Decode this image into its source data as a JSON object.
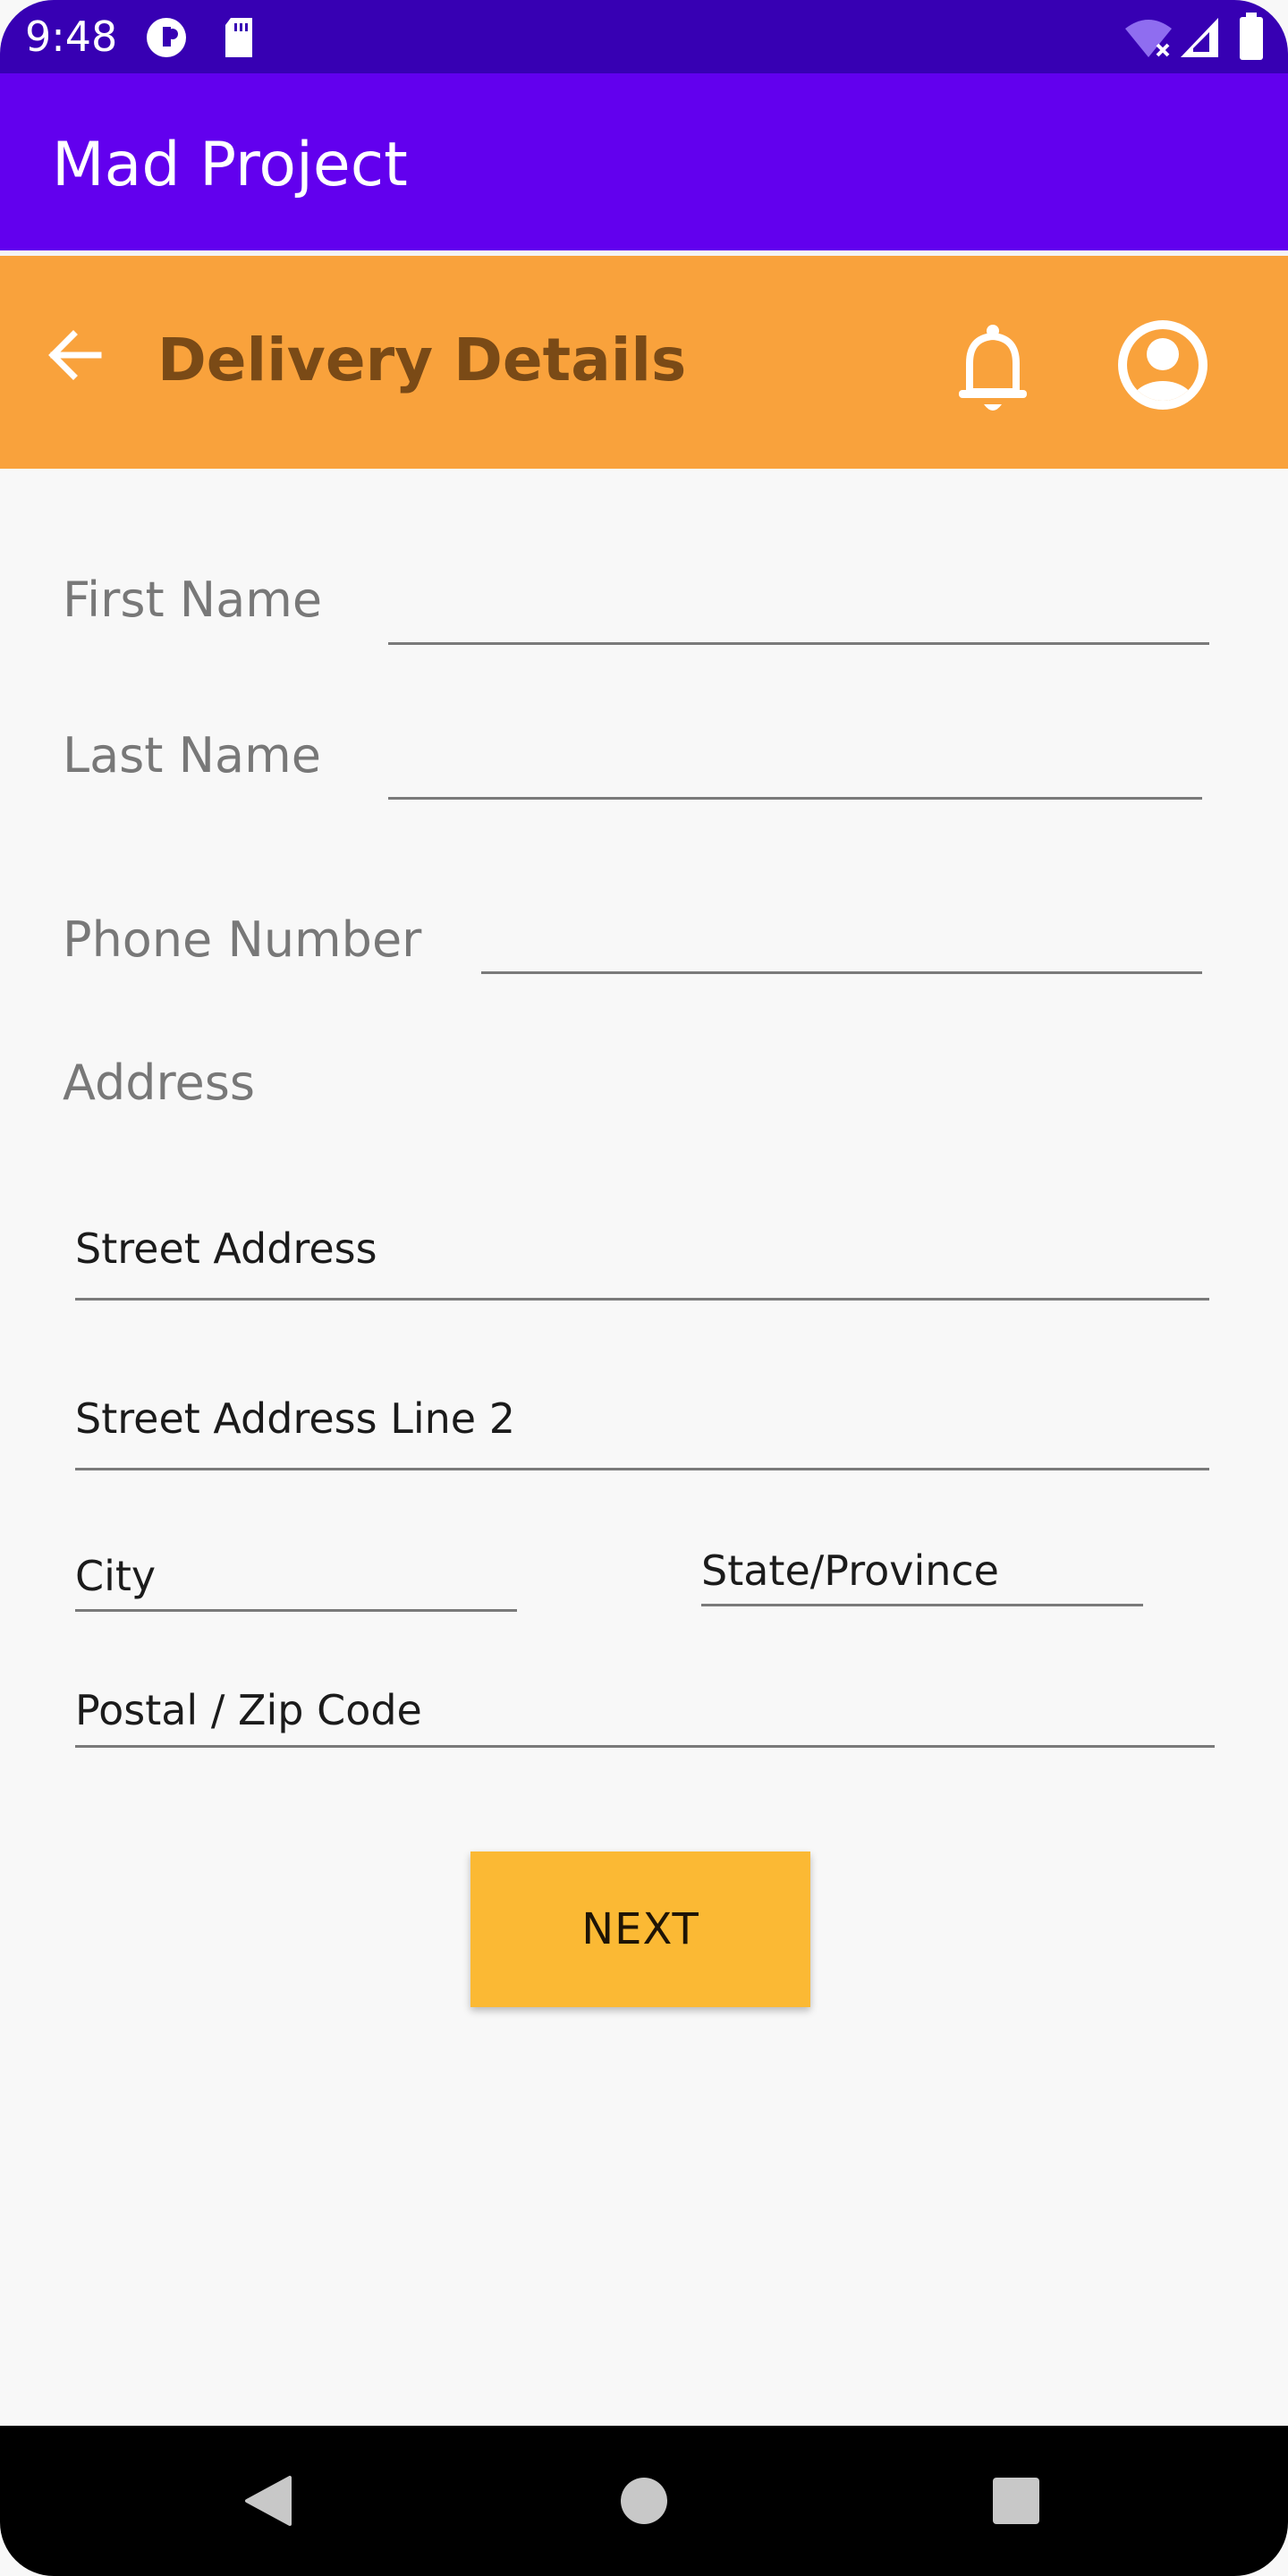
{
  "status_bar": {
    "time": "9:48",
    "icons": [
      "vpn-key-icon",
      "sd-card-icon",
      "wifi-off-icon",
      "signal-icon",
      "battery-icon"
    ]
  },
  "app_bar": {
    "title": "Mad Project",
    "color": "#6200ee"
  },
  "header": {
    "title": "Delivery Details",
    "back_icon": "arrow-left-icon",
    "notification_icon": "bell-icon",
    "account_icon": "account-circle-icon",
    "color": "#f9a23c"
  },
  "form": {
    "first_name_label": "First Name",
    "last_name_label": "Last Name",
    "phone_label": "Phone Number",
    "address_label": "Address",
    "street_placeholder": "Street Address",
    "street2_placeholder": "Street Address Line 2",
    "city_placeholder": "City",
    "state_placeholder": "State/Province",
    "postal_placeholder": "Postal / Zip Code"
  },
  "actions": {
    "next_label": "NEXT",
    "button_color": "#fbb934"
  },
  "nav_bar": {
    "back": "triangle-back-icon",
    "home": "circle-home-icon",
    "recents": "square-recents-icon"
  }
}
